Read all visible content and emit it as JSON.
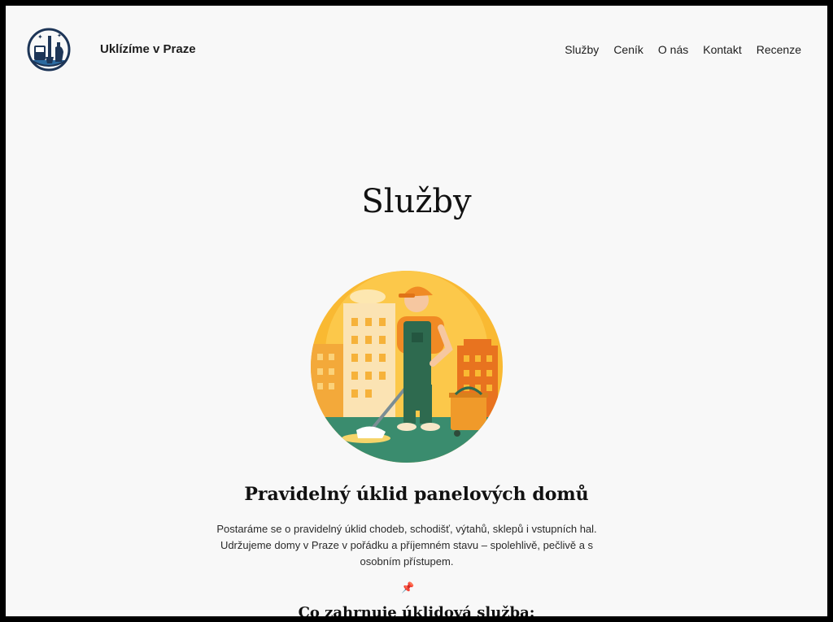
{
  "header": {
    "site_title": "Uklízíme v Praze",
    "logo_icon": "cleaning-supplies-logo",
    "nav": [
      {
        "label": "Služby"
      },
      {
        "label": "Ceník"
      },
      {
        "label": "O nás"
      },
      {
        "label": "Kontakt"
      },
      {
        "label": "Recenze"
      }
    ]
  },
  "main": {
    "page_title": "Služby",
    "hero_image": "janitor-mopping-illustration",
    "section_title": "Pravidelný úklid panelových domů",
    "section_text": "Postaráme se o pravidelný úklid chodeb, schodišť, výtahů, sklepů i vstupních hal. Udržujeme domy v Praze v pořádku a příjemném stavu – spolehlivě, pečlivě a s osobním přístupem.",
    "pin_icon": "pushpin-icon",
    "pin_glyph": "📌",
    "subsection_title": "Co zahrnuje úklidová služba:"
  },
  "colors": {
    "background": "#f8f8f8",
    "text": "#1e1e1e",
    "hero_sun": "#f9b932",
    "hero_ground": "#3a8c6e",
    "worker_shirt": "#f08a24",
    "worker_overall": "#2e6a4f"
  }
}
